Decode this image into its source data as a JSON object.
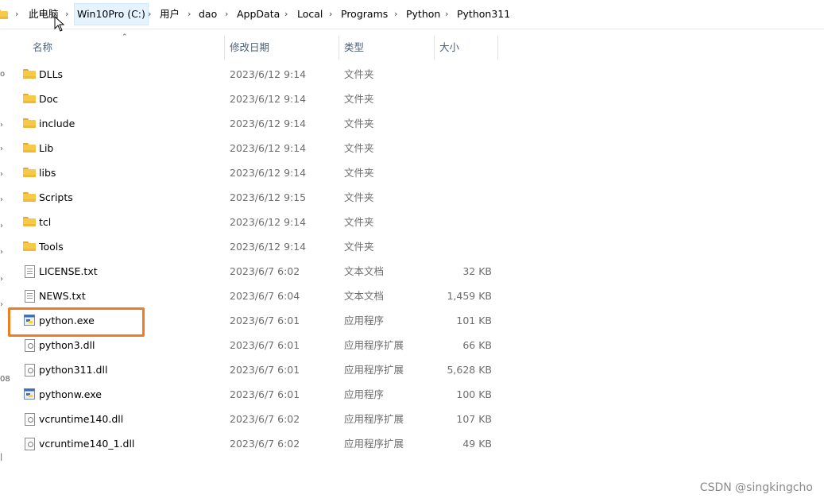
{
  "breadcrumb": {
    "items": [
      "此电脑",
      "Win10Pro (C:)",
      "用户",
      "dao",
      "AppData",
      "Local",
      "Programs",
      "Python",
      "Python311"
    ],
    "separator": "›"
  },
  "columns": {
    "name": "名称",
    "date": "修改日期",
    "type": "类型",
    "size": "大小"
  },
  "files": [
    {
      "name": "DLLs",
      "date": "2023/6/12 9:14",
      "type": "文件夹",
      "size": "",
      "icon": "folder-icon"
    },
    {
      "name": "Doc",
      "date": "2023/6/12 9:14",
      "type": "文件夹",
      "size": "",
      "icon": "folder-icon"
    },
    {
      "name": "include",
      "date": "2023/6/12 9:14",
      "type": "文件夹",
      "size": "",
      "icon": "folder-icon"
    },
    {
      "name": "Lib",
      "date": "2023/6/12 9:14",
      "type": "文件夹",
      "size": "",
      "icon": "folder-icon"
    },
    {
      "name": "libs",
      "date": "2023/6/12 9:14",
      "type": "文件夹",
      "size": "",
      "icon": "folder-icon"
    },
    {
      "name": "Scripts",
      "date": "2023/6/12 9:15",
      "type": "文件夹",
      "size": "",
      "icon": "folder-icon"
    },
    {
      "name": "tcl",
      "date": "2023/6/12 9:14",
      "type": "文件夹",
      "size": "",
      "icon": "folder-icon"
    },
    {
      "name": "Tools",
      "date": "2023/6/12 9:14",
      "type": "文件夹",
      "size": "",
      "icon": "folder-icon"
    },
    {
      "name": "LICENSE.txt",
      "date": "2023/6/7 6:02",
      "type": "文本文档",
      "size": "32 KB",
      "icon": "text-file-icon"
    },
    {
      "name": "NEWS.txt",
      "date": "2023/6/7 6:04",
      "type": "文本文档",
      "size": "1,459 KB",
      "icon": "text-file-icon"
    },
    {
      "name": "python.exe",
      "date": "2023/6/7 6:01",
      "type": "应用程序",
      "size": "101 KB",
      "icon": "python-exe-icon"
    },
    {
      "name": "python3.dll",
      "date": "2023/6/7 6:01",
      "type": "应用程序扩展",
      "size": "66 KB",
      "icon": "dll-file-icon"
    },
    {
      "name": "python311.dll",
      "date": "2023/6/7 6:01",
      "type": "应用程序扩展",
      "size": "5,628 KB",
      "icon": "dll-file-icon"
    },
    {
      "name": "pythonw.exe",
      "date": "2023/6/7 6:01",
      "type": "应用程序",
      "size": "100 KB",
      "icon": "python-exe-icon"
    },
    {
      "name": "vcruntime140.dll",
      "date": "2023/6/7 6:02",
      "type": "应用程序扩展",
      "size": "107 KB",
      "icon": "dll-file-icon"
    },
    {
      "name": "vcruntime140_1.dll",
      "date": "2023/6/7 6:02",
      "type": "应用程序扩展",
      "size": "49 KB",
      "icon": "dll-file-icon"
    }
  ],
  "highlighted_file": "python.exe",
  "watermark": "CSDN @singkingcho",
  "colors": {
    "highlight_border": "#f07c20",
    "folder_yellow": "#f7c948",
    "breadcrumb_active_bg": "#e5f3ff"
  }
}
